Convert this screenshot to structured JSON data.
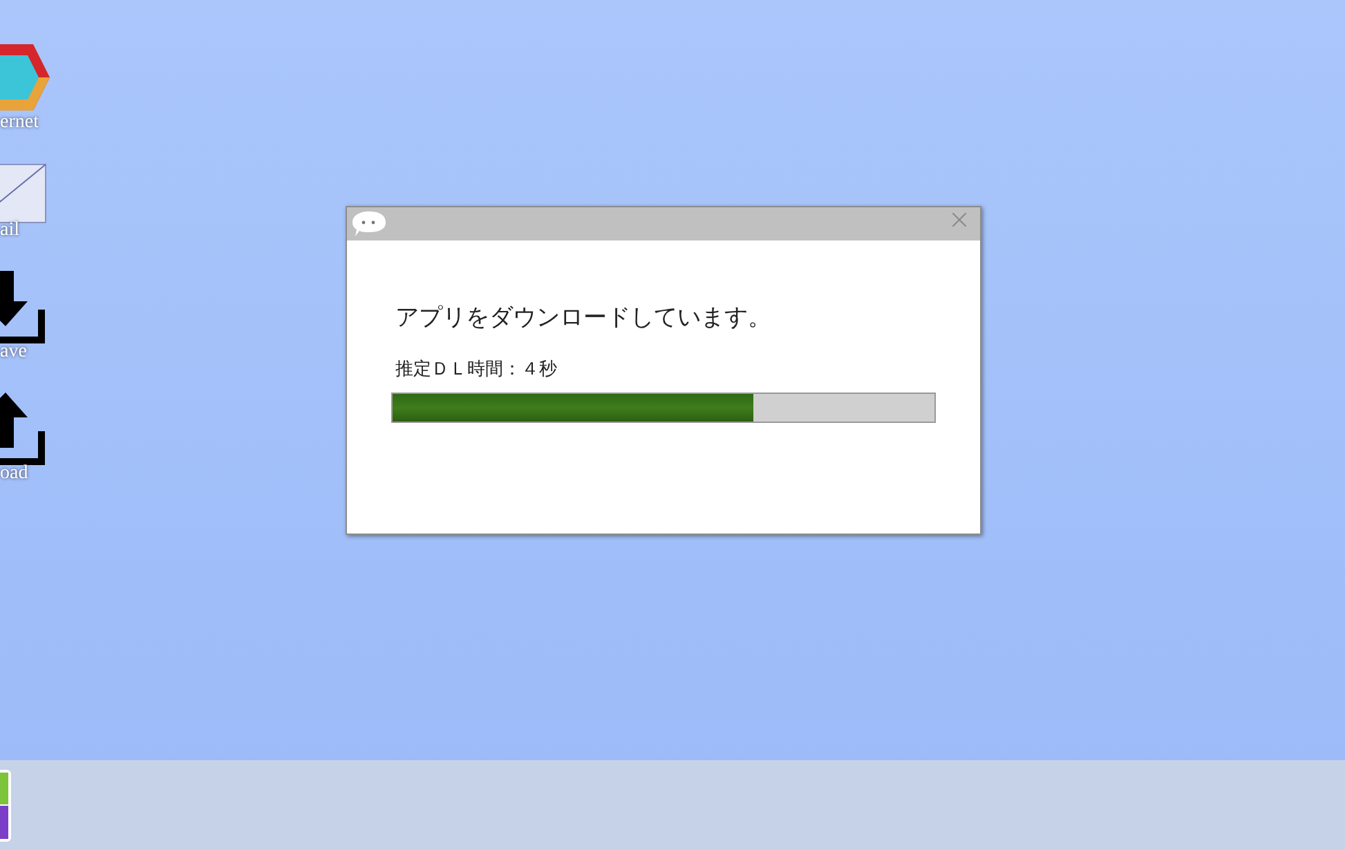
{
  "desktop_icons": [
    {
      "kind": "internet",
      "label": "ernet"
    },
    {
      "kind": "mail",
      "label": "ail"
    },
    {
      "kind": "save",
      "label": "ave"
    },
    {
      "kind": "load",
      "label": "oad"
    }
  ],
  "dialog": {
    "message": "アプリをダウンロードしています。",
    "estimate": "推定ＤＬ時間：４秒",
    "progress": {
      "level": 0.666
    }
  }
}
